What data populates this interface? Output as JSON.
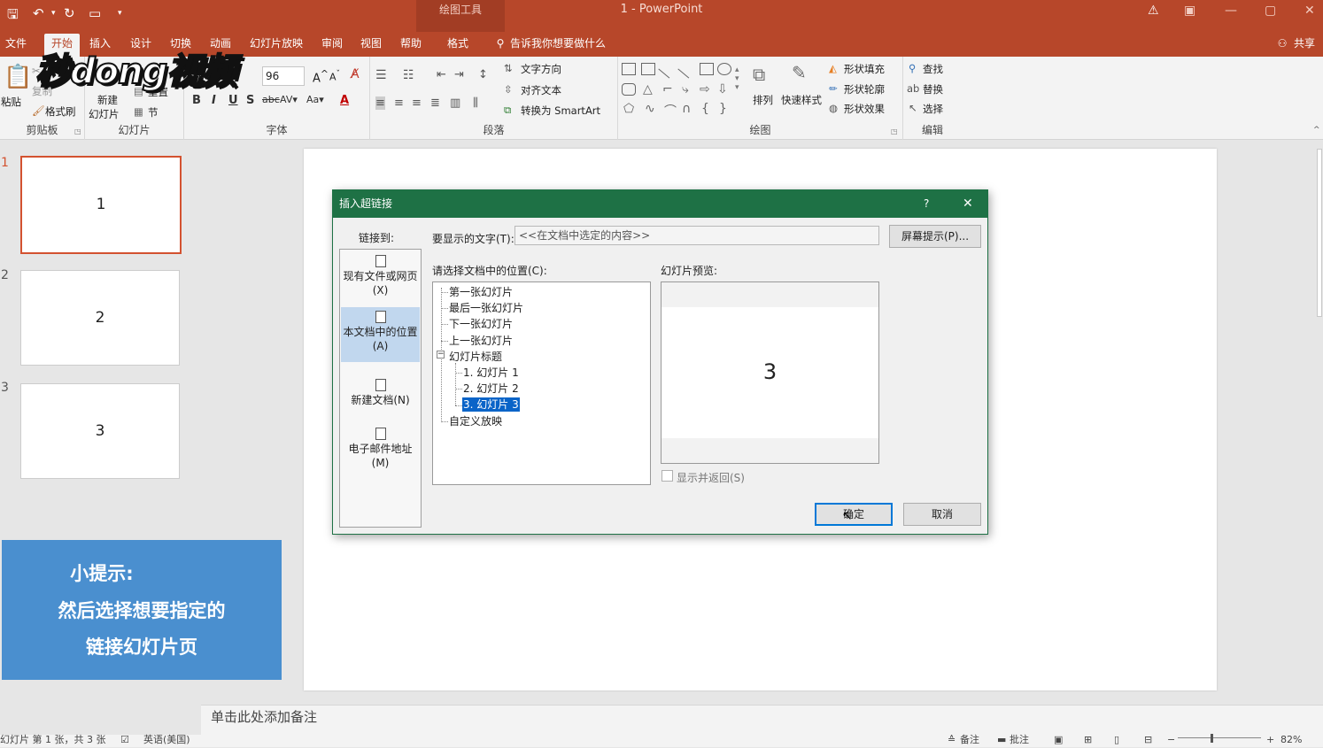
{
  "titlebar": {
    "context_tab_title": "绘图工具",
    "app_title": "1 - PowerPoint"
  },
  "tabs": [
    {
      "label": "文件"
    },
    {
      "label": "开始"
    },
    {
      "label": "插入"
    },
    {
      "label": "设计"
    },
    {
      "label": "切换"
    },
    {
      "label": "动画"
    },
    {
      "label": "幻灯片放映"
    },
    {
      "label": "审阅"
    },
    {
      "label": "视图"
    },
    {
      "label": "帮助"
    },
    {
      "label": "格式"
    }
  ],
  "tellme": "告诉我你想要做什么",
  "share": "共享",
  "watermark": "秒dong视频",
  "ribbon": {
    "clipboard": {
      "paste": "粘贴",
      "copy": "复制",
      "painter": "格式刷",
      "label": "剪贴板"
    },
    "slides": {
      "new_slide_1": "新建",
      "new_slide_2": "幻灯片",
      "reset": "重置",
      "section": "节",
      "label": "幻灯片"
    },
    "font": {
      "size": "96",
      "label": "字体"
    },
    "paragraph": {
      "text_direction": "文字方向",
      "align_text": "对齐文本",
      "smartart": "转换为 SmartArt",
      "label": "段落"
    },
    "drawing": {
      "arrange": "排列",
      "quick_styles": "快速样式",
      "fill": "形状填充",
      "outline": "形状轮廓",
      "effects": "形状效果",
      "label": "绘图"
    },
    "editing": {
      "find": "查找",
      "replace": "替换",
      "select": "选择",
      "label": "编辑"
    }
  },
  "thumbnails": [
    {
      "num": "1",
      "text": "1"
    },
    {
      "num": "2",
      "text": "2"
    },
    {
      "num": "3",
      "text": "3"
    }
  ],
  "tip": {
    "line1": "小提示:",
    "line2": "然后选择想要指定的",
    "line3": "链接幻灯片页"
  },
  "notes_placeholder": "单击此处添加备注",
  "status": {
    "left": "幻灯片 第 1 张，共 3 张",
    "lang": "英语(美国)",
    "notes": "备注",
    "comments": "批注",
    "zoom": "82%"
  },
  "dialog": {
    "title": "插入超链接",
    "help": "?",
    "close": "✕",
    "link_to_label": "链接到:",
    "text_to_display_label": "要显示的文字(T):",
    "text_to_display_value": "<<在文档中选定的内容>>",
    "screentip_button": "屏幕提示(P)...",
    "place_label": "请选择文档中的位置(C):",
    "preview_label": "幻灯片预览:",
    "link_options": [
      {
        "line1": "现有文件或网页",
        "line2": "(X)"
      },
      {
        "line1": "本文档中的位置",
        "line2": "(A)"
      },
      {
        "line1": "新建文档(N)",
        "line2": ""
      },
      {
        "line1": "电子邮件地址",
        "line2": "(M)"
      }
    ],
    "tree": {
      "first": "第一张幻灯片",
      "last": "最后一张幻灯片",
      "next": "下一张幻灯片",
      "prev": "上一张幻灯片",
      "titles": "幻灯片标题",
      "items": [
        "1. 幻灯片 1",
        "2. 幻灯片 2",
        "3. 幻灯片 3"
      ],
      "custom": "自定义放映"
    },
    "preview_text": "3",
    "show_and_return": "显示并返回(S)",
    "ok": "确定",
    "cancel": "取消"
  }
}
